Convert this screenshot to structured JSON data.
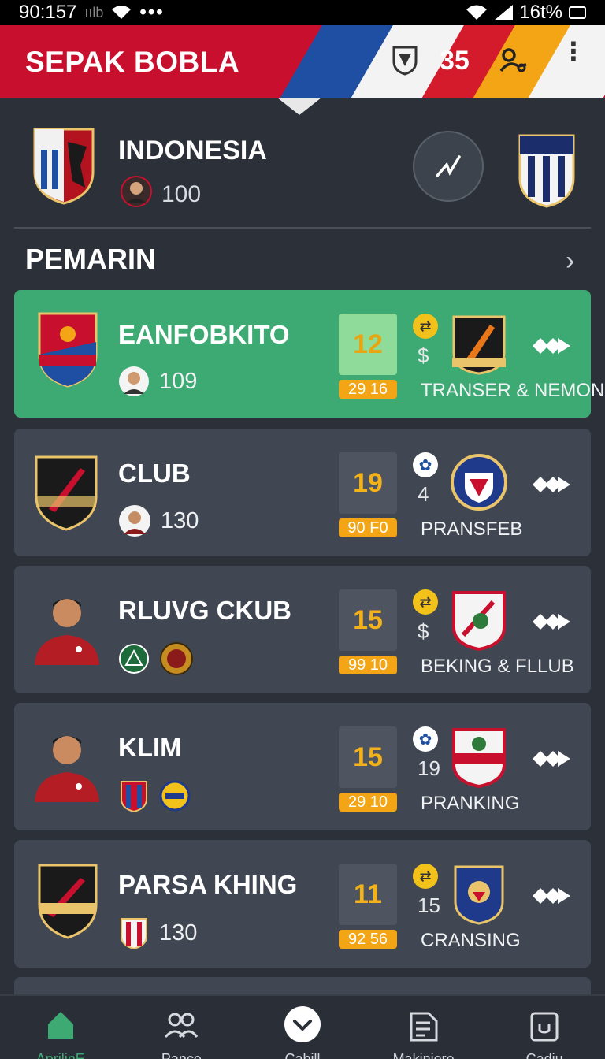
{
  "status_bar": {
    "time": "90:157",
    "signal_text": "ıılb",
    "dots": "•••",
    "battery": "16t%"
  },
  "header": {
    "title": "SEPAK BOBLA",
    "count": "35",
    "colors": {
      "red": "#c8102e",
      "blue": "#1f4fa3",
      "yellow": "#f3a515"
    }
  },
  "match": {
    "team": "INDONESIA",
    "score": "100"
  },
  "section": {
    "title": "PEMARIN"
  },
  "cards": [
    {
      "name": "EANFOBKITO",
      "value": "109",
      "rating": "12",
      "tag": "29 16",
      "stat": "$",
      "label": "TRANSER & NEMONG",
      "active": true
    },
    {
      "name": "CLUB",
      "value": "130",
      "rating": "19",
      "tag": "90 F0",
      "stat": "4",
      "label": "PRANSFEB",
      "active": false
    },
    {
      "name": "RLUVG CKUB",
      "value": "",
      "rating": "15",
      "tag": "99 10",
      "stat": "$",
      "label": "BEKING & FLLUB",
      "active": false
    },
    {
      "name": "KLIM",
      "value": "",
      "rating": "15",
      "tag": "29 10",
      "stat": "19",
      "label": "PRANKING",
      "active": false
    },
    {
      "name": "PARSA KHING",
      "value": "130",
      "rating": "11",
      "tag": "92 56",
      "stat": "15",
      "label": "CRANSING",
      "active": false
    }
  ],
  "nav": [
    {
      "label": "AprilinE",
      "icon": "home-icon",
      "active": true
    },
    {
      "label": "Pance",
      "icon": "users-icon",
      "active": false
    },
    {
      "label": "Cabill",
      "icon": "chevron-circle-icon",
      "active": false
    },
    {
      "label": "Makinjere",
      "icon": "document-icon",
      "active": false
    },
    {
      "label": "Cadiu",
      "icon": "clipboard-icon",
      "active": false
    }
  ]
}
